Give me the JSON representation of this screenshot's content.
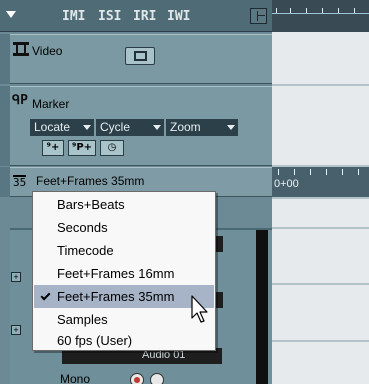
{
  "toolbar": {
    "buttons": [
      "IMI",
      "ISI",
      "IRI",
      "IWI"
    ]
  },
  "tracks": {
    "video": {
      "label": "Video"
    },
    "marker": {
      "label": "Marker",
      "dropdowns": [
        "Locate",
        "Cycle",
        "Zoom"
      ],
      "buttons": [
        "⁹+",
        "⁹P+",
        "◷"
      ]
    },
    "ruler": {
      "icon_text": "35",
      "label": "Feet+Frames 35mm"
    },
    "audio": {
      "channel_label": "Mono",
      "partial_name": "Audio 01"
    }
  },
  "timeline": {
    "ruler_text": "0+00"
  },
  "menu": {
    "items": [
      {
        "label": "Bars+Beats",
        "checked": false
      },
      {
        "label": "Seconds",
        "checked": false
      },
      {
        "label": "Timecode",
        "checked": false
      },
      {
        "label": "Feet+Frames 16mm",
        "checked": false
      },
      {
        "label": "Feet+Frames 35mm",
        "checked": true
      },
      {
        "label": "Samples",
        "checked": false
      },
      {
        "label": "60 fps (User)",
        "checked": false
      }
    ]
  },
  "colors": {
    "menu_selection": "#a7b3c7",
    "track_panel": "#7b99a3",
    "dropdown_bg": "#2b4049"
  },
  "icons": [
    "ruler-toolbar-arrow-icon",
    "list-view-icon",
    "video-track-icon",
    "lock-icon",
    "marker-track-icon",
    "ruler-35mm-icon",
    "checkmark-icon",
    "mouse-pointer-icon",
    "record-icon",
    "monitor-icon"
  ]
}
